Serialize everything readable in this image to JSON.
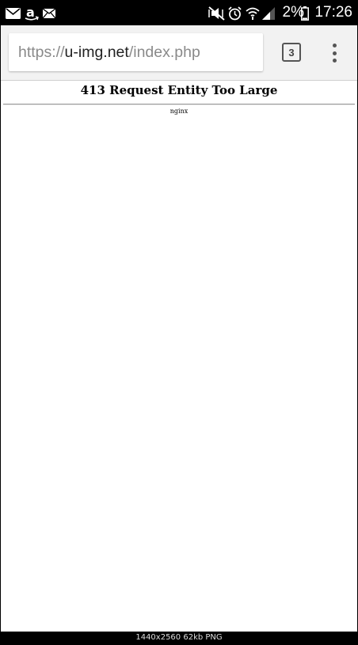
{
  "status_bar": {
    "battery_percent": "2%",
    "time": "17:26",
    "icons": [
      "mail-icon",
      "amazon-icon",
      "mail-envelope-icon",
      "mute-vibrate-icon",
      "alarm-icon",
      "wifi-icon",
      "signal-icon",
      "battery-icon"
    ]
  },
  "toolbar": {
    "url": {
      "scheme": "https://",
      "host": "u-img.net",
      "path": "/index.php"
    },
    "tab_count": "3"
  },
  "page": {
    "heading": "413 Request Entity Too Large",
    "server": "nginx"
  },
  "caption": "1440x2560 62kb PNG",
  "colors": {
    "status_bar_bg": "#000000",
    "toolbar_bg": "#f2f2f2",
    "url_muted": "#8a8a8a",
    "url_host": "#222222"
  }
}
